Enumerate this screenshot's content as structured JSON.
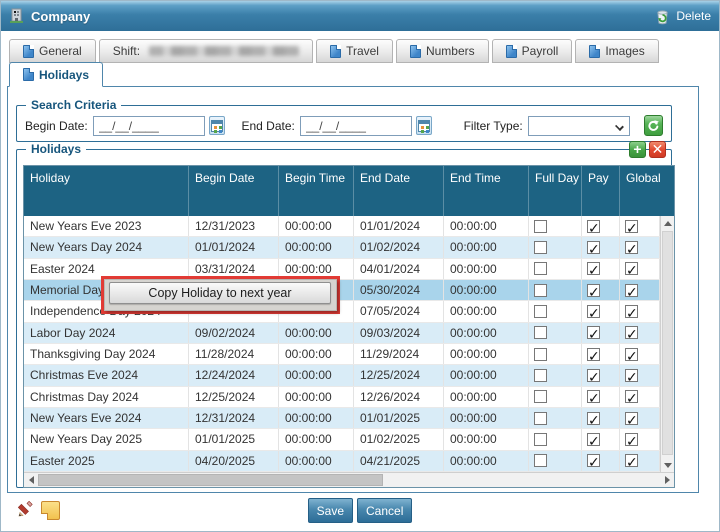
{
  "window": {
    "title": "Company",
    "delete_label": "Delete"
  },
  "tabs": {
    "row1": [
      {
        "label": "General",
        "icon": true
      },
      {
        "label": "Shift:",
        "icon": false,
        "redacted": true
      },
      {
        "label": "Travel",
        "icon": true
      },
      {
        "label": "Numbers",
        "icon": true
      },
      {
        "label": "Payroll",
        "icon": true
      },
      {
        "label": "Images",
        "icon": true
      }
    ],
    "active_tab": {
      "label": "Holidays"
    }
  },
  "search": {
    "legend": "Search Criteria",
    "begin_date_label": "Begin Date:",
    "begin_date_value": "__/__/____",
    "end_date_label": "End Date:",
    "end_date_value": "__/__/____",
    "filter_type_label": "Filter Type:",
    "filter_type_value": ""
  },
  "holidays": {
    "legend": "Holidays",
    "columns": [
      "Holiday",
      "Begin Date",
      "Begin Time",
      "End Date",
      "End Time",
      "Full Day",
      "Pay",
      "Global"
    ],
    "rows": [
      {
        "name": "New Years Eve 2023",
        "begin_date": "12/31/2023",
        "begin_time": "00:00:00",
        "end_date": "01/01/2024",
        "end_time": "00:00:00",
        "full_day": false,
        "pay": true,
        "global": true,
        "selected": false
      },
      {
        "name": "New Years Day 2024",
        "begin_date": "01/01/2024",
        "begin_time": "00:00:00",
        "end_date": "01/02/2024",
        "end_time": "00:00:00",
        "full_day": false,
        "pay": true,
        "global": true,
        "selected": false
      },
      {
        "name": "Easter 2024",
        "begin_date": "03/31/2024",
        "begin_time": "00:00:00",
        "end_date": "04/01/2024",
        "end_time": "00:00:00",
        "full_day": false,
        "pay": true,
        "global": true,
        "selected": false
      },
      {
        "name": "Memorial Day 2024",
        "begin_date": "",
        "begin_time": "",
        "end_date": "05/30/2024",
        "end_time": "00:00:00",
        "full_day": false,
        "pay": true,
        "global": true,
        "selected": true
      },
      {
        "name": "Independence Day 2024",
        "begin_date": "",
        "begin_time": "",
        "end_date": "07/05/2024",
        "end_time": "00:00:00",
        "full_day": false,
        "pay": true,
        "global": true,
        "selected": false
      },
      {
        "name": "Labor Day 2024",
        "begin_date": "09/02/2024",
        "begin_time": "00:00:00",
        "end_date": "09/03/2024",
        "end_time": "00:00:00",
        "full_day": false,
        "pay": true,
        "global": true,
        "selected": false
      },
      {
        "name": "Thanksgiving Day 2024",
        "begin_date": "11/28/2024",
        "begin_time": "00:00:00",
        "end_date": "11/29/2024",
        "end_time": "00:00:00",
        "full_day": false,
        "pay": true,
        "global": true,
        "selected": false
      },
      {
        "name": "Christmas Eve 2024",
        "begin_date": "12/24/2024",
        "begin_time": "00:00:00",
        "end_date": "12/25/2024",
        "end_time": "00:00:00",
        "full_day": false,
        "pay": true,
        "global": true,
        "selected": false
      },
      {
        "name": "Christmas Day 2024",
        "begin_date": "12/25/2024",
        "begin_time": "00:00:00",
        "end_date": "12/26/2024",
        "end_time": "00:00:00",
        "full_day": false,
        "pay": true,
        "global": true,
        "selected": false
      },
      {
        "name": "New Years Eve 2024",
        "begin_date": "12/31/2024",
        "begin_time": "00:00:00",
        "end_date": "01/01/2025",
        "end_time": "00:00:00",
        "full_day": false,
        "pay": true,
        "global": true,
        "selected": false
      },
      {
        "name": "New Years Day 2025",
        "begin_date": "01/01/2025",
        "begin_time": "00:00:00",
        "end_date": "01/02/2025",
        "end_time": "00:00:00",
        "full_day": false,
        "pay": true,
        "global": true,
        "selected": false
      },
      {
        "name": "Easter 2025",
        "begin_date": "04/20/2025",
        "begin_time": "00:00:00",
        "end_date": "04/21/2025",
        "end_time": "00:00:00",
        "full_day": false,
        "pay": true,
        "global": true,
        "selected": false
      }
    ]
  },
  "context_menu": {
    "label": "Copy Holiday to next year"
  },
  "footer": {
    "save_label": "Save",
    "cancel_label": "Cancel"
  },
  "icons": {
    "titlebar": "building-icon",
    "delete": "recycle-bin-icon",
    "tabs": "document-icon",
    "date_picker": "calendar-icon",
    "search_go": "refresh-arrow-icon",
    "grid_add": "plus-icon",
    "grid_remove": "x-icon",
    "footer": [
      "pencil-icon",
      "notes-icon"
    ]
  },
  "colors": {
    "titlebar": "#3b7fa9",
    "header_bg": "#1d6383",
    "row_alt": "#d9ecf7",
    "row_selected": "#a9d4eb",
    "annotation_red": "#e23b35",
    "accent_border": "#2e6e96",
    "green_button": "#46a546",
    "red_button": "#e1472f"
  }
}
